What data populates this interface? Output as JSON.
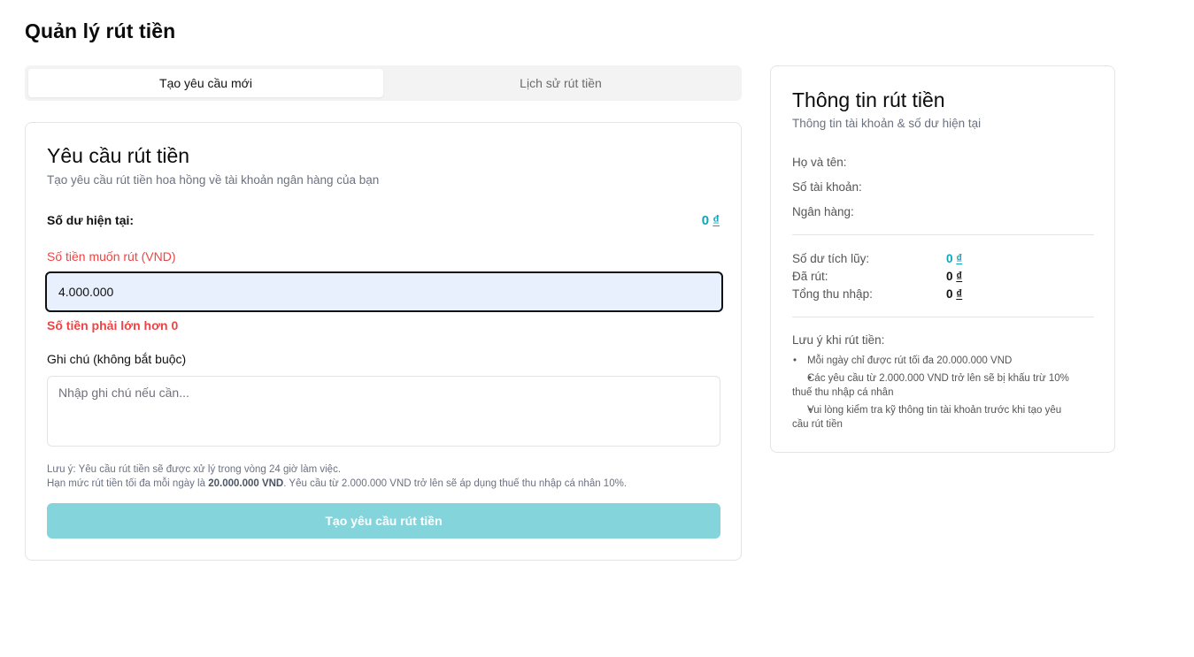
{
  "page": {
    "title": "Quản lý rút tiền"
  },
  "tabs": [
    {
      "label": "Tạo yêu cầu mới",
      "active": true
    },
    {
      "label": "Lịch sử rút tiền",
      "active": false
    }
  ],
  "form": {
    "title": "Yêu cầu rút tiền",
    "subtitle": "Tạo yêu cầu rút tiền hoa hồng về tài khoản ngân hàng của bạn",
    "balance_label": "Số dư hiện tại:",
    "balance_amount": "0",
    "currency_symbol": "₫",
    "amount_label": "Số tiền muốn rút (VND)",
    "amount_value": "4.000.000",
    "amount_error": "Số tiền phải lớn hơn 0",
    "note_label": "Ghi chú (không bắt buộc)",
    "note_value": "",
    "note_placeholder": "Nhập ghi chú nếu cần...",
    "hint_line1": "Lưu ý: Yêu cầu rút tiền sẽ được xử lý trong vòng 24 giờ làm việc.",
    "hint_line2_prefix": "Hạn mức rút tiền tối đa mỗi ngày là ",
    "hint_line2_bold": "20.000.000 VND",
    "hint_line2_suffix": ". Yêu cầu từ 2.000.000 VND trở lên sẽ áp dụng thuế thu nhập cá nhân 10%.",
    "submit_label": "Tạo yêu cầu rút tiền"
  },
  "info": {
    "title": "Thông tin rút tiền",
    "subtitle": "Thông tin tài khoản & số dư hiện tại",
    "name_label": "Họ và tên:",
    "account_label": "Số tài khoản:",
    "bank_label": "Ngân hàng:",
    "accumulated_label": "Số dư tích lũy:",
    "accumulated_amount": "0",
    "withdrawn_label": "Đã rút:",
    "withdrawn_amount": "0",
    "income_label": "Tổng thu nhập:",
    "income_amount": "0",
    "currency_symbol": "₫",
    "notes_title": "Lưu ý khi rút tiền:",
    "notes": [
      "Mỗi ngày chỉ được rút tối đa 20.000.000 VND",
      "Các yêu cầu từ 2.000.000 VND trở lên sẽ bị khấu trừ 10% thuế thu nhập cá nhân",
      "Vui lòng kiểm tra kỹ thông tin tài khoản trước khi tạo yêu cầu rút tiền"
    ]
  },
  "colors": {
    "accent": "#0ea5b7",
    "error": "#ef4444",
    "button_disabled": "#84d4db",
    "input_bg": "#e8f0fd"
  }
}
